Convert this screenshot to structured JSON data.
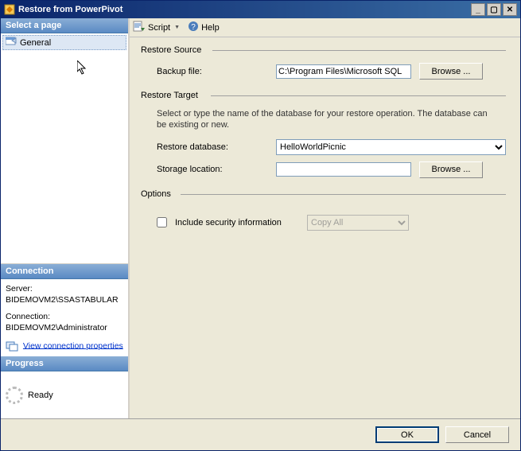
{
  "window": {
    "title": "Restore from PowerPivot",
    "buttons": {
      "min": "_",
      "max": "▢",
      "close": "✕"
    }
  },
  "sidebar": {
    "pages_header": "Select a page",
    "pages": [
      {
        "label": "General",
        "selected": true
      }
    ],
    "connection_header": "Connection",
    "connection": {
      "server_label": "Server:",
      "server_value": "BIDEMOVM2\\SSASTABULAR",
      "conn_label": "Connection:",
      "conn_value": "BIDEMOVM2\\Administrator",
      "view_link": "View connection properties"
    },
    "progress_header": "Progress",
    "progress_status": "Ready"
  },
  "toolbar": {
    "script": "Script",
    "help": "Help"
  },
  "form": {
    "restore_source": "Restore Source",
    "backup_file_label": "Backup file:",
    "backup_file_value": "C:\\Program Files\\Microsoft SQL",
    "browse": "Browse ...",
    "restore_target": "Restore Target",
    "target_desc": "Select or type the name of the database for your restore operation. The database can be existing or new.",
    "restore_db_label": "Restore database:",
    "restore_db_value": "HelloWorldPicnic",
    "storage_label": "Storage location:",
    "storage_value": "",
    "options": "Options",
    "include_sec": "Include security information",
    "copy_all": "Copy All"
  },
  "buttons": {
    "ok": "OK",
    "cancel": "Cancel"
  }
}
